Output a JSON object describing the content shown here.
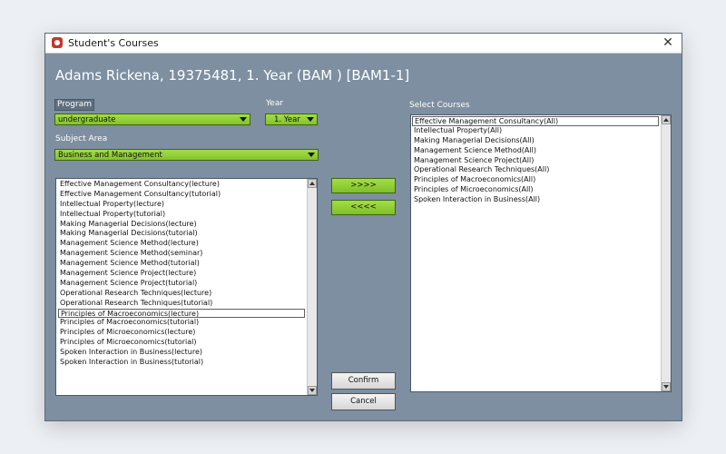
{
  "window": {
    "title": "Student's Courses",
    "close_glyph": "✕",
    "icon": "app-icon"
  },
  "student": {
    "header": "Adams Rickena, 19375481, 1. Year (BAM ) [BAM1-1]"
  },
  "form": {
    "program_label": "Program",
    "program_value": "undergraduate",
    "year_label": "Year",
    "year_value": "1. Year",
    "subject_area_label": "Subject Area",
    "subject_area_value": "Business and Management"
  },
  "available_courses": [
    "Effective Management Consultancy(lecture)",
    "Effective Management Consultancy(tutorial)",
    "Intellectual Property(lecture)",
    "Intellectual Property(tutorial)",
    "Making Managerial Decisions(lecture)",
    "Making Managerial Decisions(tutorial)",
    "Management Science Method(lecture)",
    "Management Science Method(seminar)",
    "Management Science Method(tutorial)",
    "Management Science Project(lecture)",
    "Management Science Project(tutorial)",
    "Operational Research Techniques(lecture)",
    "Operational Research Techniques(tutorial)",
    "Principles of Macroeconomics(lecture)",
    "Principles of Macroeconomics(tutorial)",
    "Principles of Microeconomics(lecture)",
    "Principles of Microeconomics(tutorial)",
    "Spoken Interaction in Business(lecture)",
    "Spoken Interaction in Business(tutorial)"
  ],
  "available_selected_index": 13,
  "selected_courses_label": "Select Courses",
  "selected_courses": [
    "Effective Management Consultancy(All)",
    "Intellectual Property(All)",
    "Making Managerial Decisions(All)",
    "Management Science Method(All)",
    "Management Science Project(All)",
    "Operational Research Techniques(All)",
    "Principles of Macroeconomics(All)",
    "Principles of Microeconomics(All)",
    "Spoken Interaction in Business(All)"
  ],
  "selected_selected_index": 0,
  "buttons": {
    "add": ">>>>",
    "remove": "<<<<",
    "confirm": "Confirm",
    "cancel": "Cancel"
  },
  "colors": {
    "window_bg": "#7d8fa1",
    "accent_green": "#92cf36"
  }
}
